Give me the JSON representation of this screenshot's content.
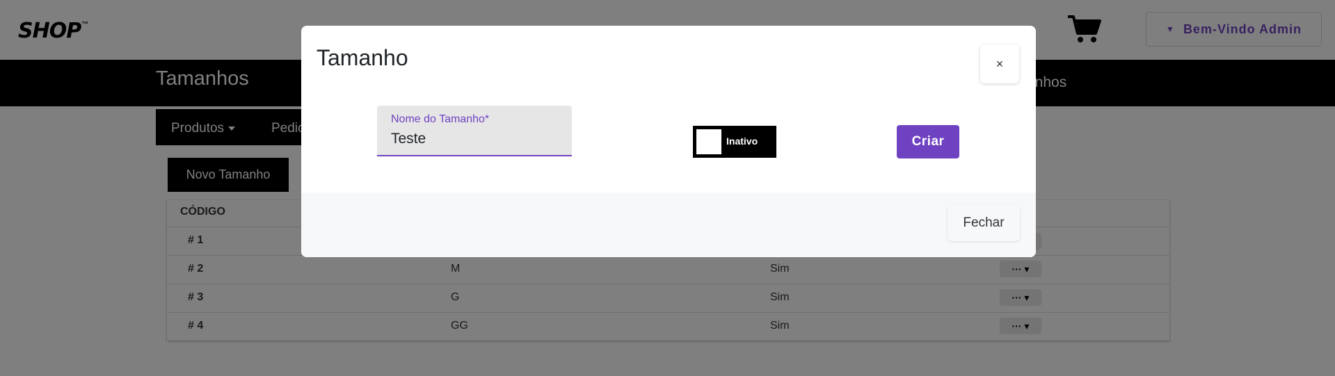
{
  "header": {
    "logo": "SHOP",
    "logo_tm": "™",
    "cart_icon": "cart-icon",
    "welcome_label": "Bem-Vindo Admin"
  },
  "page": {
    "title": "Tamanhos",
    "bar_right_text": "anhos"
  },
  "menu": {
    "items": [
      {
        "label": "Produtos",
        "has_caret": true
      },
      {
        "label": "Pedic",
        "has_caret": false
      }
    ]
  },
  "toolbar": {
    "new_button_label": "Novo Tamanho"
  },
  "table": {
    "headers": [
      "CÓDIGO"
    ],
    "rows": [
      {
        "code": "# 1",
        "name": "",
        "active": "",
        "actions": "··· ▾"
      },
      {
        "code": "# 2",
        "name": "M",
        "active": "Sim",
        "actions": "··· ▾"
      },
      {
        "code": "# 3",
        "name": "G",
        "active": "Sim",
        "actions": "··· ▾"
      },
      {
        "code": "# 4",
        "name": "GG",
        "active": "Sim",
        "actions": "··· ▾"
      }
    ]
  },
  "modal": {
    "title": "Tamanho",
    "close_symbol": "×",
    "field_label": "Nome do Tamanho*",
    "field_value": "Teste",
    "toggle_label": "Inativo",
    "create_label": "Criar",
    "footer_close_label": "Fechar"
  },
  "colors": {
    "accent": "#6f42c1",
    "black_bar": "#000000",
    "backdrop": "rgba(0,0,0,0.5)"
  }
}
